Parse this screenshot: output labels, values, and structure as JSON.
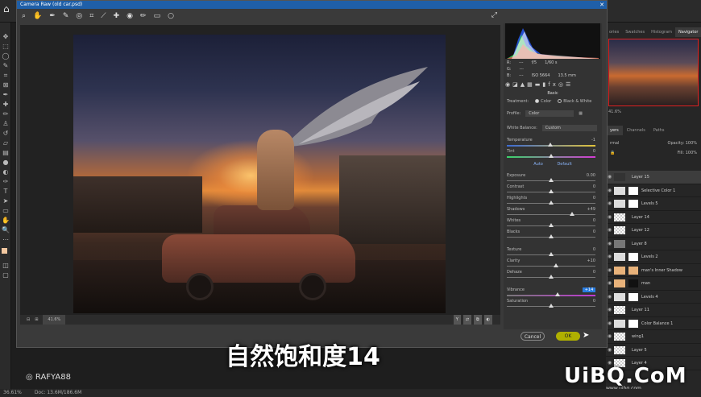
{
  "dialog": {
    "title": "Camera Raw (old car.psd)"
  },
  "canvas": {
    "zoom": "41.6%"
  },
  "histogram": {
    "rgb": {
      "r": "R:",
      "g": "G:",
      "b": "B:",
      "dash": "---"
    },
    "meta": {
      "aperture": "f/5",
      "shutter": "1/60 s",
      "iso": "ISO 5664",
      "focal": "13.5 mm"
    }
  },
  "panel": {
    "section": "Basic",
    "treatment_label": "Treatment:",
    "treatment_options": [
      "Color",
      "Black & White"
    ],
    "profile_label": "Profile:",
    "profile_value": "Color",
    "wb_label": "White Balance:",
    "wb_value": "Custom",
    "auto": "Auto",
    "default": "Default",
    "sliders": [
      {
        "label": "Temperature",
        "value": "-1"
      },
      {
        "label": "Tint",
        "value": "0"
      },
      {
        "label": "Exposure",
        "value": "0.00"
      },
      {
        "label": "Contrast",
        "value": "0"
      },
      {
        "label": "Highlights",
        "value": "0"
      },
      {
        "label": "Shadows",
        "value": "+49"
      },
      {
        "label": "Whites",
        "value": "0"
      },
      {
        "label": "Blacks",
        "value": "0"
      },
      {
        "label": "Texture",
        "value": "0"
      },
      {
        "label": "Clarity",
        "value": "+10"
      },
      {
        "label": "Dehaze",
        "value": "0"
      },
      {
        "label": "Vibrance",
        "value": "+14"
      },
      {
        "label": "Saturation",
        "value": "0"
      }
    ]
  },
  "slider_positions": [
    0.49,
    0.5,
    0.5,
    0.5,
    0.5,
    0.74,
    0.5,
    0.5,
    0.5,
    0.55,
    0.5,
    0.57,
    0.5
  ],
  "buttons": {
    "cancel": "Cancel",
    "ok": "OK"
  },
  "ps": {
    "tabs": [
      "ories",
      "Swatches",
      "Histogram",
      "Navigator"
    ],
    "nav_zoom": "41.6%",
    "layer_tabs": [
      "yers",
      "Channels",
      "Paths"
    ],
    "blend": "rmal",
    "opacity_label": "Opacity:",
    "opacity": "100%",
    "fill_label": "Fill:",
    "fill": "100%",
    "layers": [
      "Layer 15",
      "Selective Color 1",
      "Levels 5",
      "Layer 14",
      "Layer 12",
      "Layer 8",
      "Levels 2",
      "man's Inner Shadow",
      "man",
      "Levels 4",
      "Layer 11",
      "Color Balance 1",
      "wing1",
      "Layer 5",
      "Layer 4"
    ],
    "status": {
      "zoom": "36.61%",
      "doc": "Doc: 13.6M/186.6M"
    }
  },
  "subtitle": "自然饱和度14",
  "watermark": "RAFYA88",
  "logo": "UiBQ.CoM",
  "logo_sub": "www.uibq.com"
}
